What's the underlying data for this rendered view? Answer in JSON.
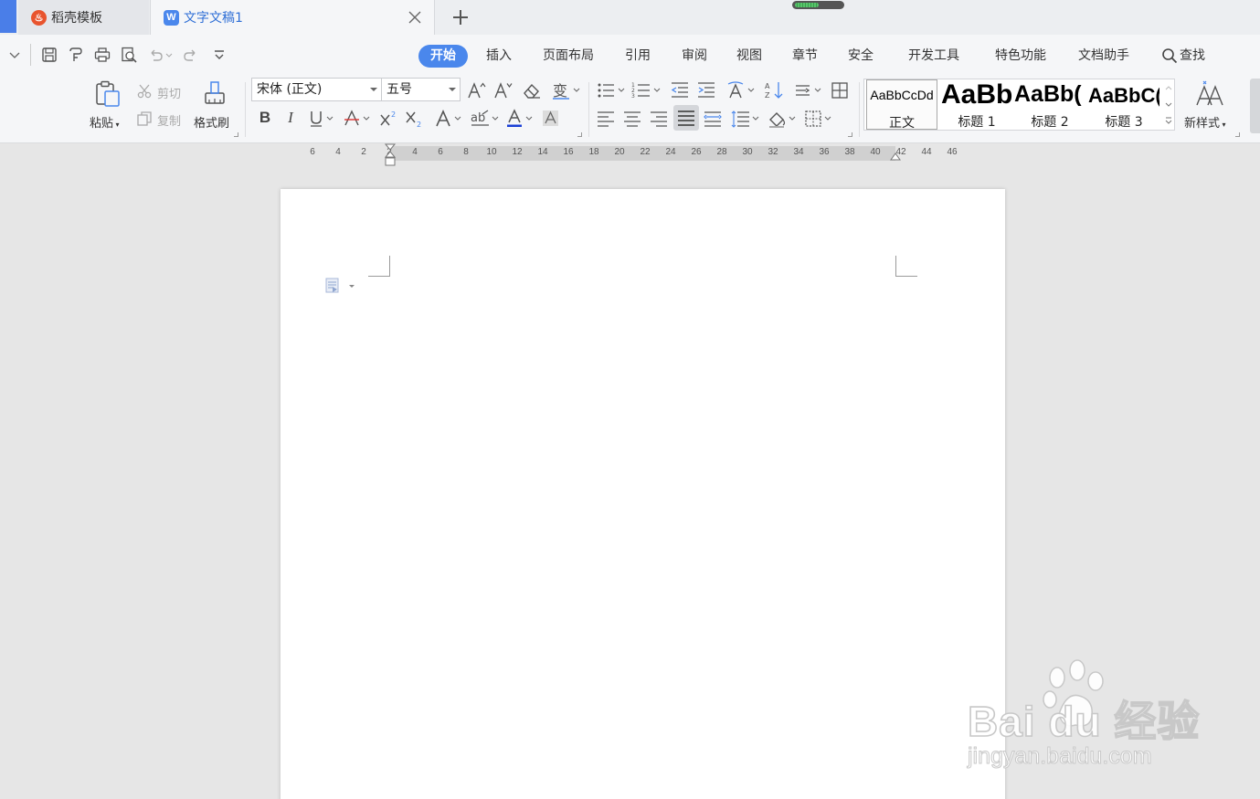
{
  "tabs": {
    "template_label": "稻壳模板",
    "doc_label": "文字文稿1",
    "new_tab_icon": "plus-icon"
  },
  "menu": {
    "items": [
      "开始",
      "插入",
      "页面布局",
      "引用",
      "审阅",
      "视图",
      "章节",
      "安全",
      "开发工具",
      "特色功能",
      "文档助手"
    ],
    "search_label": "查找",
    "active": "开始"
  },
  "ribbon": {
    "paste_label": "粘贴",
    "cut_label": "剪切",
    "copy_label": "复制",
    "format_painter_label": "格式刷",
    "font_family": "宋体 (正文)",
    "font_size": "五号",
    "bold": "B",
    "italic": "I",
    "new_style_label": "新样式"
  },
  "styles": [
    {
      "sample": "AaBbCcDd",
      "name": "正文"
    },
    {
      "sample": "AaBb",
      "name": "标题 1"
    },
    {
      "sample": "AaBb(",
      "name": "标题 2"
    },
    {
      "sample": "AaBbC(",
      "name": "标题 3"
    }
  ],
  "ruler": {
    "numbers": [
      "6",
      "4",
      "2",
      "2",
      "4",
      "6",
      "8",
      "10",
      "12",
      "14",
      "16",
      "18",
      "20",
      "22",
      "24",
      "26",
      "28",
      "30",
      "32",
      "34",
      "36",
      "38",
      "40",
      "42",
      "44",
      "46"
    ]
  },
  "watermark": {
    "brand": "Bai du 经验",
    "url": "jingyan.baidu.com"
  },
  "colors": {
    "accent": "#4a87ec",
    "doc_tab_text": "#2f6fd6",
    "template_logo": "#e8542e",
    "font_color_underline": "#1a3fd6"
  }
}
